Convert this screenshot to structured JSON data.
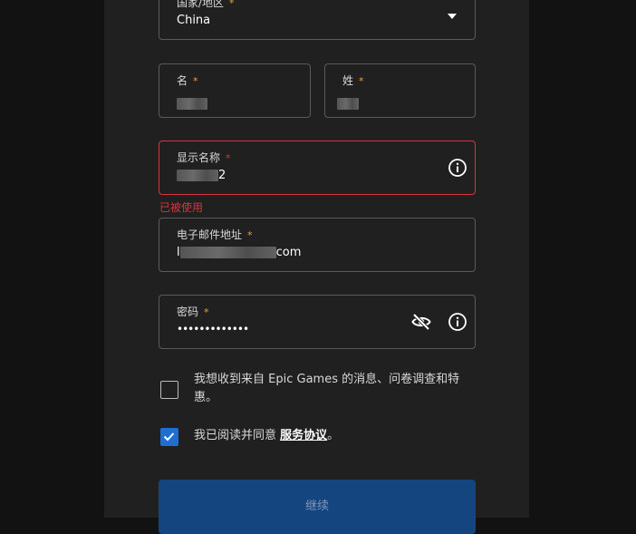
{
  "country": {
    "label": "国家/地区",
    "required_mark": "*",
    "value": "China",
    "icon": "chevron-down-icon"
  },
  "first_name": {
    "label": "名",
    "required_mark": "*",
    "value_visible": ""
  },
  "last_name": {
    "label": "姓",
    "required_mark": "*",
    "value_visible": ""
  },
  "display_name": {
    "label": "显示名称",
    "required_mark": "*",
    "value_visible_suffix": "2",
    "icon": "info-icon",
    "error": "已被使用"
  },
  "email": {
    "label": "电子邮件地址",
    "required_mark": "*",
    "value_visible_prefix": "l",
    "value_visible_suffix": "com"
  },
  "password": {
    "label": "密码",
    "required_mark": "*",
    "value": "•••••••••••••",
    "icons": [
      "eye-slash-icon",
      "info-icon"
    ]
  },
  "marketing_opt_in": {
    "checked": false,
    "text": "我想收到来自 Epic Games 的消息、问卷调查和特惠。"
  },
  "terms": {
    "checked": true,
    "text_before": "我已阅读并同意 ",
    "link": "服务协议",
    "text_after": "。"
  },
  "submit": {
    "label": "继续"
  },
  "colors": {
    "accent": "#1f6fd0",
    "error": "#d8323f",
    "required": "#f0a030",
    "button": "#14457f"
  }
}
